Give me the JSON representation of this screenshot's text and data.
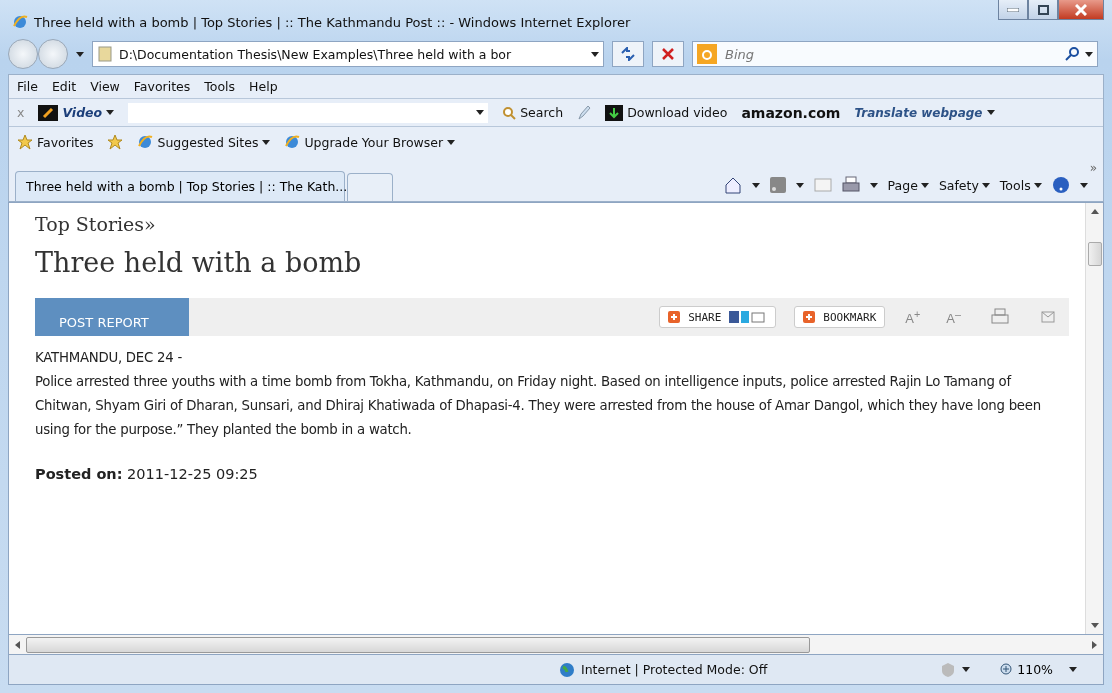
{
  "window": {
    "title": "Three held with a bomb | Top Stories | :: The Kathmandu Post :: - Windows Internet Explorer"
  },
  "address": {
    "value": "D:\\Documentation Thesis\\New Examples\\Three held with a bor"
  },
  "search": {
    "placeholder": "Bing"
  },
  "menu": [
    "File",
    "Edit",
    "View",
    "Favorites",
    "Tools",
    "Help"
  ],
  "toolbar": {
    "close": "x",
    "video": "Video",
    "search_button": "Search",
    "download": "Download video",
    "amazon": "amazon.com",
    "translate": "Translate webpage"
  },
  "favorites_bar": {
    "favorites": "Favorites",
    "links": [
      "Suggested Sites",
      "Upgrade Your Browser"
    ]
  },
  "tabs": [
    {
      "label": "Three held with a bomb | Top Stories | :: The Kath...",
      "selected": true
    },
    {
      "selected": false
    }
  ],
  "command_bar": [
    "Page",
    "Safety",
    "Tools"
  ],
  "overflow": "»",
  "article": {
    "section": "Top Stories»",
    "headline": "Three held with a bomb",
    "tab": "POST REPORT",
    "share": "SHARE",
    "bookmark": "BOOKMARK",
    "font_up": "A$^{+}$",
    "font_down": "A$^{–}$",
    "dateline": "KATHMANDU, DEC 24 -",
    "body": "Police arrested three youths with a time bomb from Tokha, Kathmandu, on Friday night. Based on intelligence inputs, police arrested Rajin Lo Tamang of Chitwan, Shyam Giri of Dharan, Sunsari, and Dhiraj Khatiwada of Dhapasi-4. They were arrested from the house of Amar Dangol, which they have long been using for the purpose.” They planted the bomb in a watch.",
    "posted": "**Posted on:** 2011-12-25 09:25"
  },
  "status_bar": {
    "zone": "Internet | Protected Mode: Off",
    "zoom": "110%"
  }
}
